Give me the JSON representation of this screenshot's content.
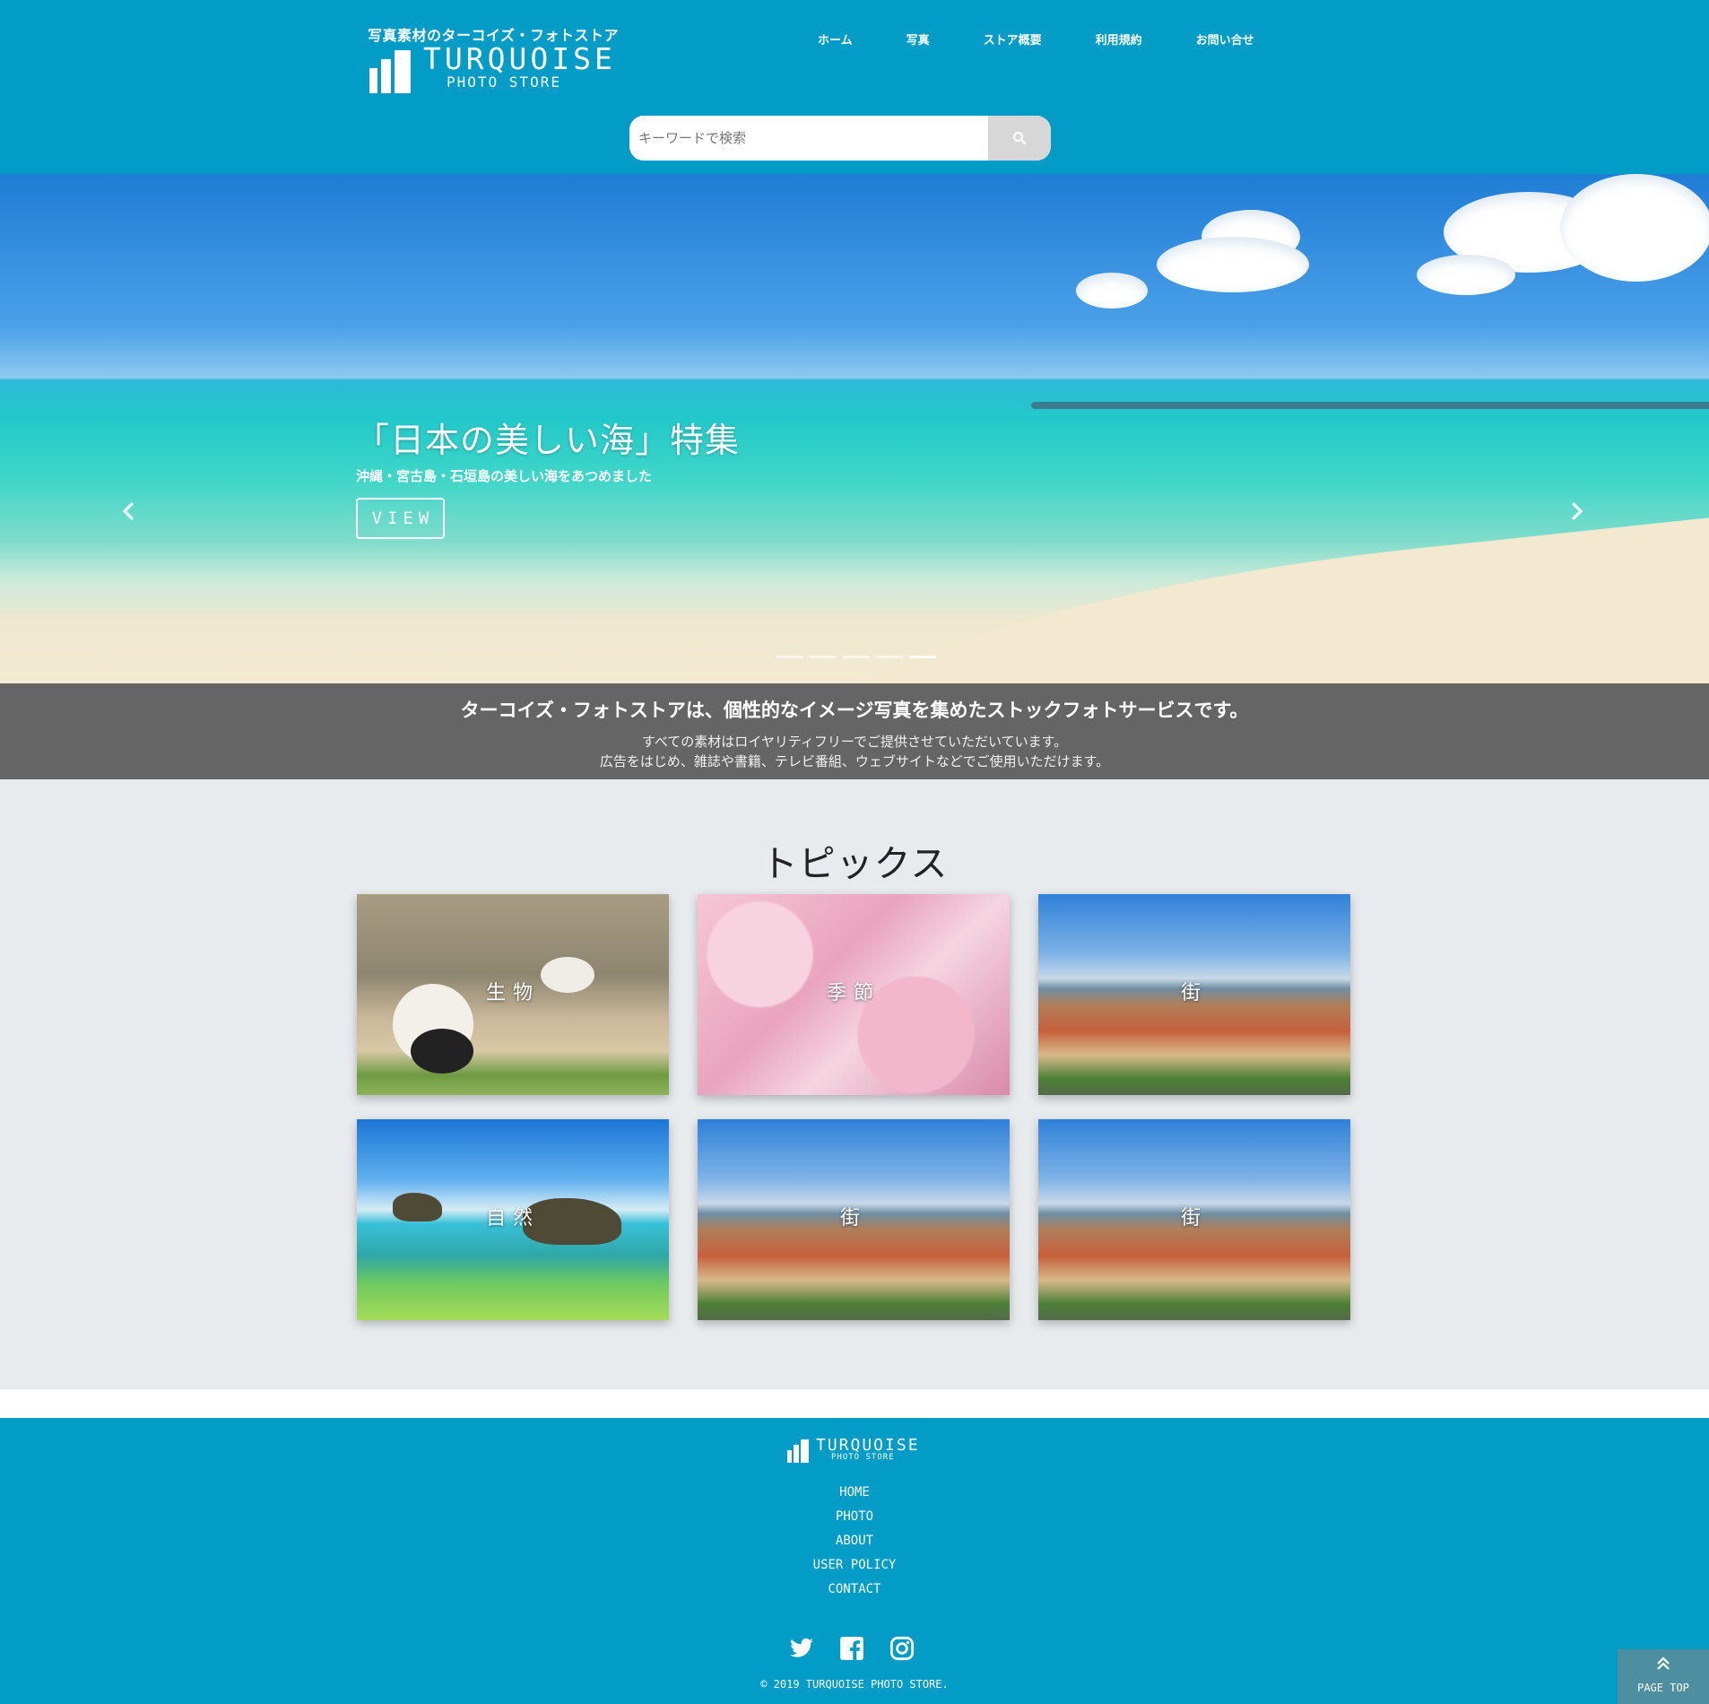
{
  "header": {
    "tagline": "写真素材のターコイズ・フォトストア",
    "logo_word": "TURQUOISE",
    "logo_sub": "PHOTO STORE",
    "nav": [
      "ホーム",
      "写真",
      "ストア概要",
      "利用規約",
      "お問い合せ"
    ],
    "search": {
      "placeholder": "キーワードで検索",
      "button_icon": "search-icon"
    }
  },
  "hero": {
    "title": "「日本の美しい海」特集",
    "subtitle": "沖縄・宮古島・石垣島の美しい海をあつめました",
    "button_label": "VIEW",
    "prev_icon": "chevron-left-icon",
    "next_icon": "chevron-right-icon",
    "slide_count": 5,
    "active_slide": 5
  },
  "intro": {
    "title": "ターコイズ・フォトストアは、個性的なイメージ写真を集めたストックフォトサービスです。",
    "line1": "すべての素材はロイヤリティフリーでご提供させていただいています。",
    "line2": "広告をはじめ、雑誌や書籍、テレビ番組、ウェブサイトなどでご使用いただけます。"
  },
  "topics": {
    "title": "トピックス",
    "cards": [
      {
        "label": "生物",
        "image": "panda"
      },
      {
        "label": "季節",
        "image": "cherry-blossom"
      },
      {
        "label": "街",
        "image": "city"
      },
      {
        "label": "自然",
        "image": "sea-rock"
      },
      {
        "label": "街",
        "image": "city"
      },
      {
        "label": "街",
        "image": "city"
      }
    ]
  },
  "footer": {
    "logo_word": "TURQUOISE",
    "logo_sub": "PHOTO STORE",
    "nav": [
      "HOME",
      "PHOTO",
      "ABOUT",
      "USER POLICY",
      "CONTACT"
    ],
    "social": [
      "twitter-icon",
      "facebook-icon",
      "instagram-icon"
    ],
    "copyright": "© 2019 TURQUOISE PHOTO STORE.",
    "page_top_label": "PAGE TOP"
  },
  "colors": {
    "brand": "#029cc6",
    "intro_band": "#656565",
    "topics_bg": "#e8ebee",
    "page_top": "#4d8fa1"
  }
}
